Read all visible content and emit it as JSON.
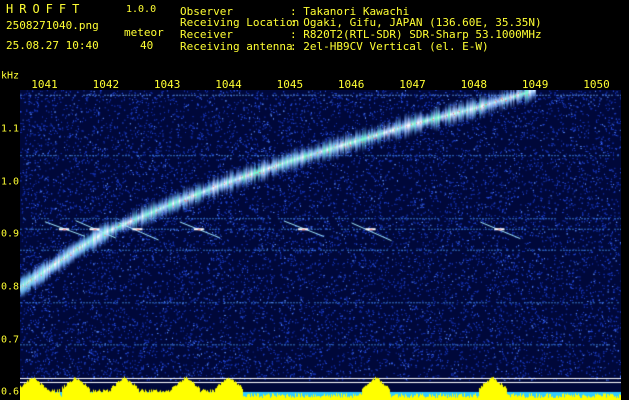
{
  "header": {
    "app_name": "HROFFT",
    "app_version": "1.0.0",
    "file_name": "2508271040.png",
    "date_time": "25.08.27 10:40",
    "meteor_label": "meteor",
    "meteor_count": "40",
    "info": [
      {
        "label": "Observer",
        "value": ": Takanori Kawachi"
      },
      {
        "label": "Receiving Location",
        "value": ": Ogaki, Gifu, JAPAN (136.60E, 35.35N)"
      },
      {
        "label": "Receiver",
        "value": ": R820T2(RTL-SDR) SDR-Sharp 53.1000MHz"
      },
      {
        "label": "Receiving antenna",
        "value": ": 2el-HB9CV Vertical (el. E-W)"
      }
    ]
  },
  "colors": {
    "text": "#ffff33",
    "background": "#000000",
    "plot_bg": "#00083a",
    "noise": "#1a3cc8",
    "echo": "#ffffff",
    "level": "#ffff00",
    "level_base": "#33ccff"
  },
  "chart_data": {
    "type": "heatmap",
    "x_unit": "",
    "y_unit": "kHz",
    "x_ticks": [
      "1041",
      "1042",
      "1043",
      "1044",
      "1045",
      "1046",
      "1047",
      "1048",
      "1049",
      "1050"
    ],
    "x_range": [
      1040.6,
      1050.4
    ],
    "y_ticks": [
      "0.6",
      "0.7",
      "0.8",
      "0.9",
      "1.0",
      "1.1"
    ],
    "y_range": [
      0.585,
      1.175
    ],
    "dominant_trace": [
      {
        "x": 1040.6,
        "y": 0.8
      },
      {
        "x": 1041.0,
        "y": 0.83
      },
      {
        "x": 1041.5,
        "y": 0.87
      },
      {
        "x": 1042.0,
        "y": 0.905
      },
      {
        "x": 1043.0,
        "y": 0.955
      },
      {
        "x": 1044.0,
        "y": 1.0
      },
      {
        "x": 1045.0,
        "y": 1.04
      },
      {
        "x": 1046.0,
        "y": 1.075
      },
      {
        "x": 1047.0,
        "y": 1.11
      },
      {
        "x": 1048.0,
        "y": 1.14
      },
      {
        "x": 1049.0,
        "y": 1.175
      }
    ],
    "carrier_lines_khz": [
      1.165,
      1.05,
      0.93,
      0.91,
      0.87,
      0.77,
      0.69
    ],
    "meteor_bursts_x": [
      1041.3,
      1041.8,
      1042.5,
      1043.5,
      1045.2,
      1046.3,
      1048.4
    ],
    "level_bursts_x": [
      1040.8,
      1041.5,
      1042.3,
      1043.3,
      1044.0,
      1046.4,
      1048.3
    ]
  }
}
